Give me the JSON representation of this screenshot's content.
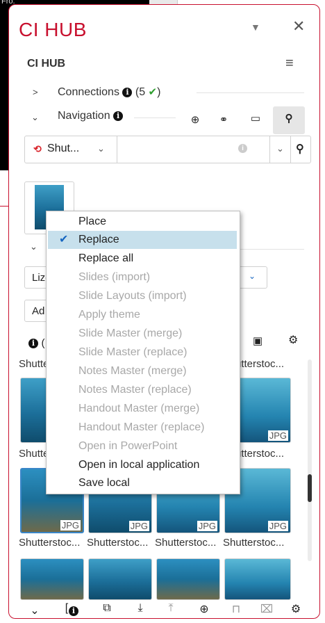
{
  "background": {
    "corner_text": "Fro."
  },
  "panel": {
    "title": "CI HUB",
    "title_dropdown": "▼",
    "title_close": "✕",
    "subtitle": "CI HUB",
    "menu_icon": "≡"
  },
  "connections": {
    "label": "Connections",
    "count": "(5",
    "check": "✔",
    "close": ")"
  },
  "navigation": {
    "label": "Navigation"
  },
  "search": {
    "provider": "Shut...",
    "value": ""
  },
  "filter": {
    "select_value": "Lize",
    "add_button": "Ad",
    "info_label": "("
  },
  "grid": {
    "row1_captions": [
      "Shutte",
      "",
      "",
      "utterstoc..."
    ],
    "row2_captions": [
      "Shutte",
      "",
      "",
      "utterstoc..."
    ],
    "row3_captions": [
      "Shutterstoc...",
      "Shutterstoc...",
      "Shutterstoc...",
      "Shutterstoc..."
    ],
    "jpg_label": "JPG"
  },
  "context_menu": {
    "items": [
      {
        "label": "Place",
        "enabled": true
      },
      {
        "label": "Replace",
        "enabled": true,
        "selected": true
      },
      {
        "label": "Replace all",
        "enabled": true
      },
      {
        "label": "Slides (import)",
        "enabled": false
      },
      {
        "label": "Slide Layouts (import)",
        "enabled": false
      },
      {
        "label": "Apply theme",
        "enabled": false
      },
      {
        "label": "Slide Master (merge)",
        "enabled": false
      },
      {
        "label": "Slide Master (replace)",
        "enabled": false
      },
      {
        "label": "Notes Master (merge)",
        "enabled": false
      },
      {
        "label": "Notes Master (replace)",
        "enabled": false
      },
      {
        "label": "Handout Master (merge)",
        "enabled": false
      },
      {
        "label": "Handout Master (replace)",
        "enabled": false
      },
      {
        "label": "Open in PowerPoint",
        "enabled": false
      },
      {
        "label": "Open in local application",
        "enabled": true
      },
      {
        "label": "Save local",
        "enabled": true
      }
    ]
  },
  "colors": {
    "accent": "#c8102e",
    "selection": "#c7e0ec",
    "check": "#1565c0"
  }
}
